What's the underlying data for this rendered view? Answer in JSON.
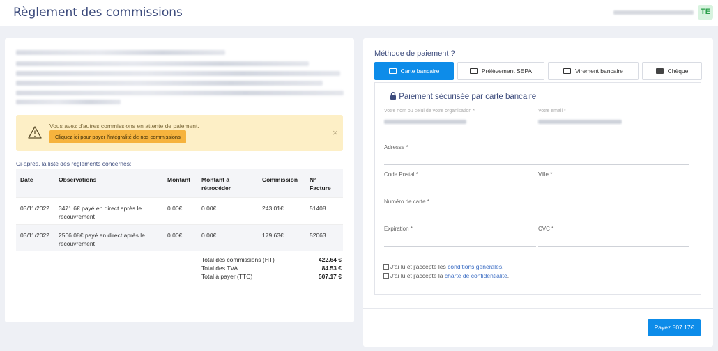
{
  "header": {
    "title": "Règlement des commissions",
    "avatar_initials": "TE"
  },
  "alert": {
    "message": "Vous avez d'autres commissions en attente de paiement.",
    "button_label": "Cliquez ici pour payer l'intégralité de nos commissions",
    "close_symbol": "×"
  },
  "list": {
    "title": "Ci-après, la liste des règlements concernés:",
    "columns": [
      "Date",
      "Observations",
      "Montant",
      "Montant à rétrocéder",
      "Commission",
      "N° Facture"
    ],
    "rows": [
      {
        "date": "03/11/2022",
        "observations": "3471.6€ payé en direct après le recouvrement",
        "montant": "0.00€",
        "retroceder": "0.00€",
        "commission": "243.01€",
        "facture": "51408"
      },
      {
        "date": "03/11/2022",
        "observations": "2566.08€ payé en direct après le recouvrement",
        "montant": "0.00€",
        "retroceder": "0.00€",
        "commission": "179.63€",
        "facture": "52063"
      }
    ],
    "totals": [
      {
        "label": "Total des commissions (HT)",
        "value": "422.64 €"
      },
      {
        "label": "Total des TVA",
        "value": "84.53 €"
      },
      {
        "label": "Total à payer (TTC)",
        "value": "507.17 €"
      }
    ]
  },
  "payment": {
    "title": "Méthode de paiement ?",
    "tabs": [
      "Carte bancaire",
      "Prélèvement SEPA",
      "Virement bancaire",
      "Chèque"
    ],
    "active_tab": "Carte bancaire",
    "secure_title": "Paiement sécurisée par carte bancaire",
    "fields": {
      "name": "Votre nom ou celui de votre organisation *",
      "email": "Votre email *",
      "address": "Adresse *",
      "postal": "Code Postal *",
      "city": "Ville *",
      "card": "Numéro de carte *",
      "expiration": "Expiration *",
      "cvc": "CVC *"
    },
    "cgv_prefix": "J'ai lu et j'accepte les ",
    "cgv_link": "conditions générales",
    "cgv_suffix": ".",
    "privacy_prefix": "J'ai lu et j'accepte la ",
    "privacy_link": "charte de confidentialité",
    "privacy_suffix": ".",
    "pay_button": "Payez 507.17€"
  },
  "colors": {
    "accent": "#0d8ce9",
    "title": "#3c4b7c",
    "alert_bg": "#fdefc6",
    "alert_button": "#f6b33d",
    "avatar_bg": "#d8f3df"
  }
}
